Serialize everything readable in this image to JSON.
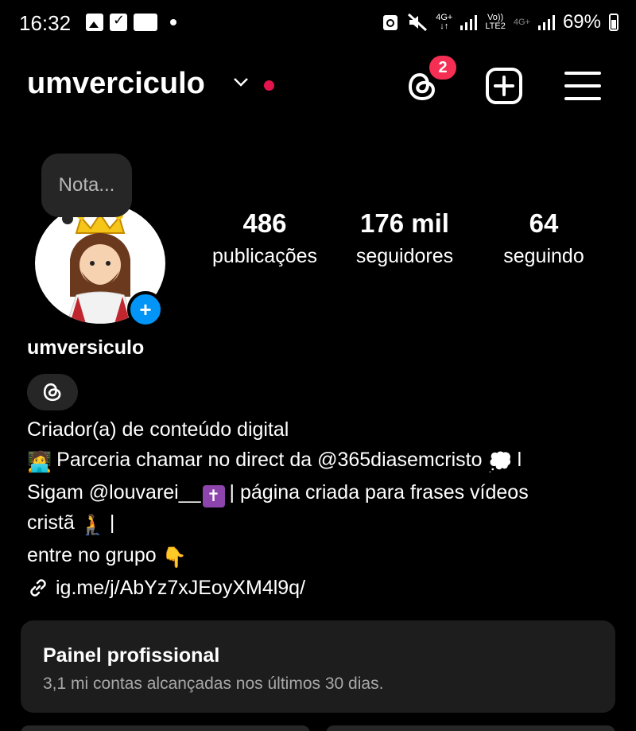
{
  "status_bar": {
    "time": "16:32",
    "network_1": "4G+",
    "network_2_top": "Vo))",
    "network_2_bottom": "LTE2",
    "network_3": "4G+",
    "battery": "69%"
  },
  "header": {
    "username": "umverciculo",
    "threads_badge": "2"
  },
  "profile": {
    "note": "Nota...",
    "stats": [
      {
        "value": "486",
        "label": "publicações"
      },
      {
        "value": "176 mil",
        "label": "seguidores"
      },
      {
        "value": "64",
        "label": "seguindo"
      }
    ],
    "name": "umversiculo",
    "bio": {
      "category": "Criador(a) de conteúdo digital",
      "line1": "Parceria chamar no direct da @365diasemcristo",
      "line1_end": "l",
      "line2_a": "Sigam @louvarei__",
      "line2_b": "| página criada para frases vídeos",
      "line3_a": "cristã",
      "line3_b": "|",
      "line4": "entre no grupo",
      "link": "ig.me/j/AbYz7xJEoyXM4l9q/"
    }
  },
  "panel": {
    "title": "Painel profissional",
    "subtitle": "3,1 mi contas alcançadas nos últimos 30 dias."
  },
  "colors": {
    "background": "#000000",
    "accent_blue": "#0095f6",
    "badge_red": "#f42f53",
    "panel_bg": "#1d1d1d"
  }
}
